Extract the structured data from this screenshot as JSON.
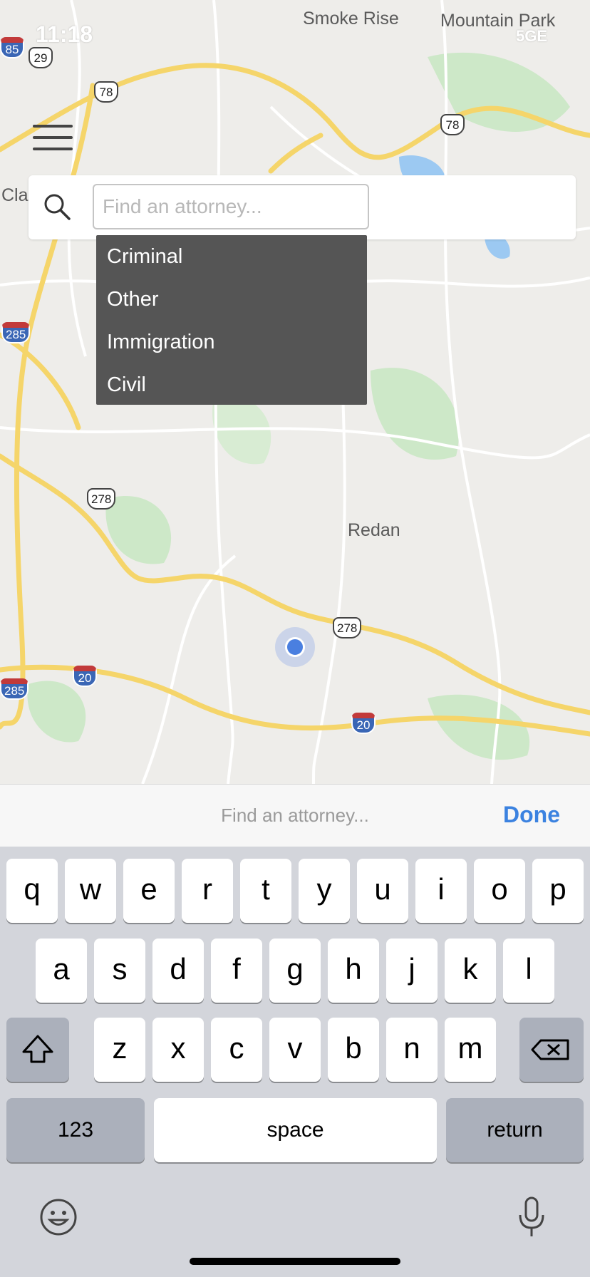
{
  "status_bar": {
    "time": "11:18",
    "network": "5GE"
  },
  "map": {
    "labels": {
      "smoke_rise": "Smoke Rise",
      "mountain_park": "Mountain Park",
      "redan": "Redan",
      "cla": "Cla"
    },
    "shields": {
      "us29": "29",
      "us78_a": "78",
      "us78_b": "78",
      "us278_a": "278",
      "us278_b": "278",
      "i85": "85",
      "i285_a": "285",
      "i285_b": "285",
      "i20_a": "20",
      "i20_b": "20"
    }
  },
  "search": {
    "placeholder": "Find an attorney..."
  },
  "dropdown": {
    "items": [
      {
        "label": "Criminal"
      },
      {
        "label": "Other"
      },
      {
        "label": "Immigration"
      },
      {
        "label": "Civil"
      }
    ]
  },
  "keyboard_accessory": {
    "placeholder": "Find an attorney...",
    "done_label": "Done"
  },
  "keyboard": {
    "row1": [
      "q",
      "w",
      "e",
      "r",
      "t",
      "y",
      "u",
      "i",
      "o",
      "p"
    ],
    "row2": [
      "a",
      "s",
      "d",
      "f",
      "g",
      "h",
      "j",
      "k",
      "l"
    ],
    "row3": [
      "z",
      "x",
      "c",
      "v",
      "b",
      "n",
      "m"
    ],
    "numbers_label": "123",
    "space_label": "space",
    "return_label": "return"
  },
  "colors": {
    "accent": "#3b82e0",
    "dropdown_bg": "#555555",
    "road": "#f5d56a",
    "park": "#cde8c8",
    "water": "#9cc9f2"
  }
}
